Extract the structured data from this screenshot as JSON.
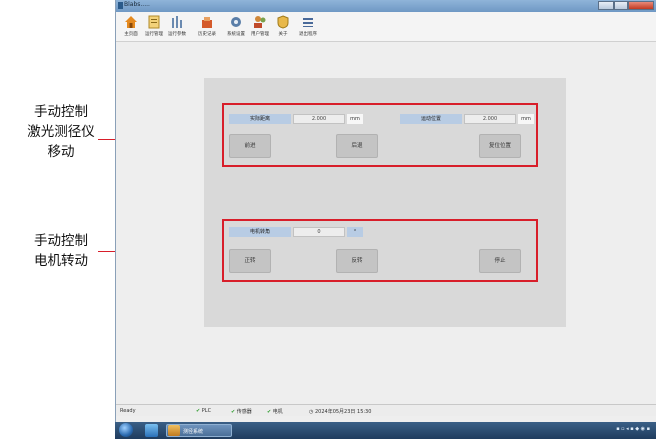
{
  "annotations": {
    "laser": [
      "手动控制",
      "激光测径仪",
      "移动"
    ],
    "motor": [
      "手动控制",
      "电机转动"
    ]
  },
  "window": {
    "title": "Blabs.....",
    "toolbar": [
      {
        "label": "主页面",
        "icon": "home-icon"
      },
      {
        "label": "运行管理",
        "icon": "document-icon"
      },
      {
        "label": "运行参数",
        "icon": "bars-icon"
      },
      {
        "label": "历史记录",
        "icon": "history-icon"
      },
      {
        "label": "系统设置",
        "icon": "gear-icon"
      },
      {
        "label": "用户管理",
        "icon": "users-icon"
      },
      {
        "label": "关于",
        "icon": "shield-icon"
      },
      {
        "label": "退出程序",
        "icon": "exit-icon"
      }
    ]
  },
  "laser_section": {
    "label1": "实际距离",
    "value1": "2.000",
    "unit1": "mm",
    "label2": "运动位置",
    "value2": "2.000",
    "unit2": "mm",
    "buttons": {
      "forward": "前进",
      "back": "后退",
      "reset": "复位位置"
    }
  },
  "motor_section": {
    "label": "电机转角",
    "value": "0",
    "unit": "°",
    "buttons": {
      "cw": "正转",
      "ccw": "反转",
      "stop": "停止"
    }
  },
  "status_bar": {
    "status": "Ready",
    "item1": "PLC",
    "item2": "传感器",
    "item3": "电机",
    "time": "2024年05月23日 15:30"
  },
  "taskbar": {
    "app": "测径系统"
  },
  "colors": {
    "highlight": "#d81e2a",
    "label_bg": "#b8cce4",
    "panel_bg": "#d9d9d9",
    "button_bg": "#c4c4c4"
  }
}
